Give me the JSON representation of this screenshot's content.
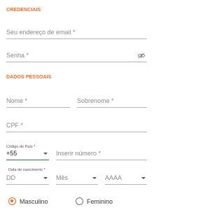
{
  "credentials": {
    "title": "CREDENCIAIS",
    "email_placeholder": "Seu endereço de email *",
    "password_placeholder": "Senha *",
    "toggle_icon": "eye-off-icon"
  },
  "personal": {
    "title": "DADOS PESSOAIS",
    "first_name_placeholder": "Nome *",
    "last_name_placeholder": "Sobrenome *",
    "cpf_placeholder": "CPF *",
    "country_code_label": "Código do País *",
    "country_code_value": "+55",
    "phone_placeholder": "Inserir número *",
    "birth_date_label": "Data de nascimento *",
    "day_value": "DD",
    "month_value": "Mês",
    "year_value": "AAAA"
  },
  "gender": {
    "options": [
      "Masculino",
      "Feminino"
    ],
    "selected": "Masculino",
    "accent_color": "#f26a21"
  },
  "colors": {
    "accent": "#f26a21",
    "active_underline": "#2e7d32"
  }
}
